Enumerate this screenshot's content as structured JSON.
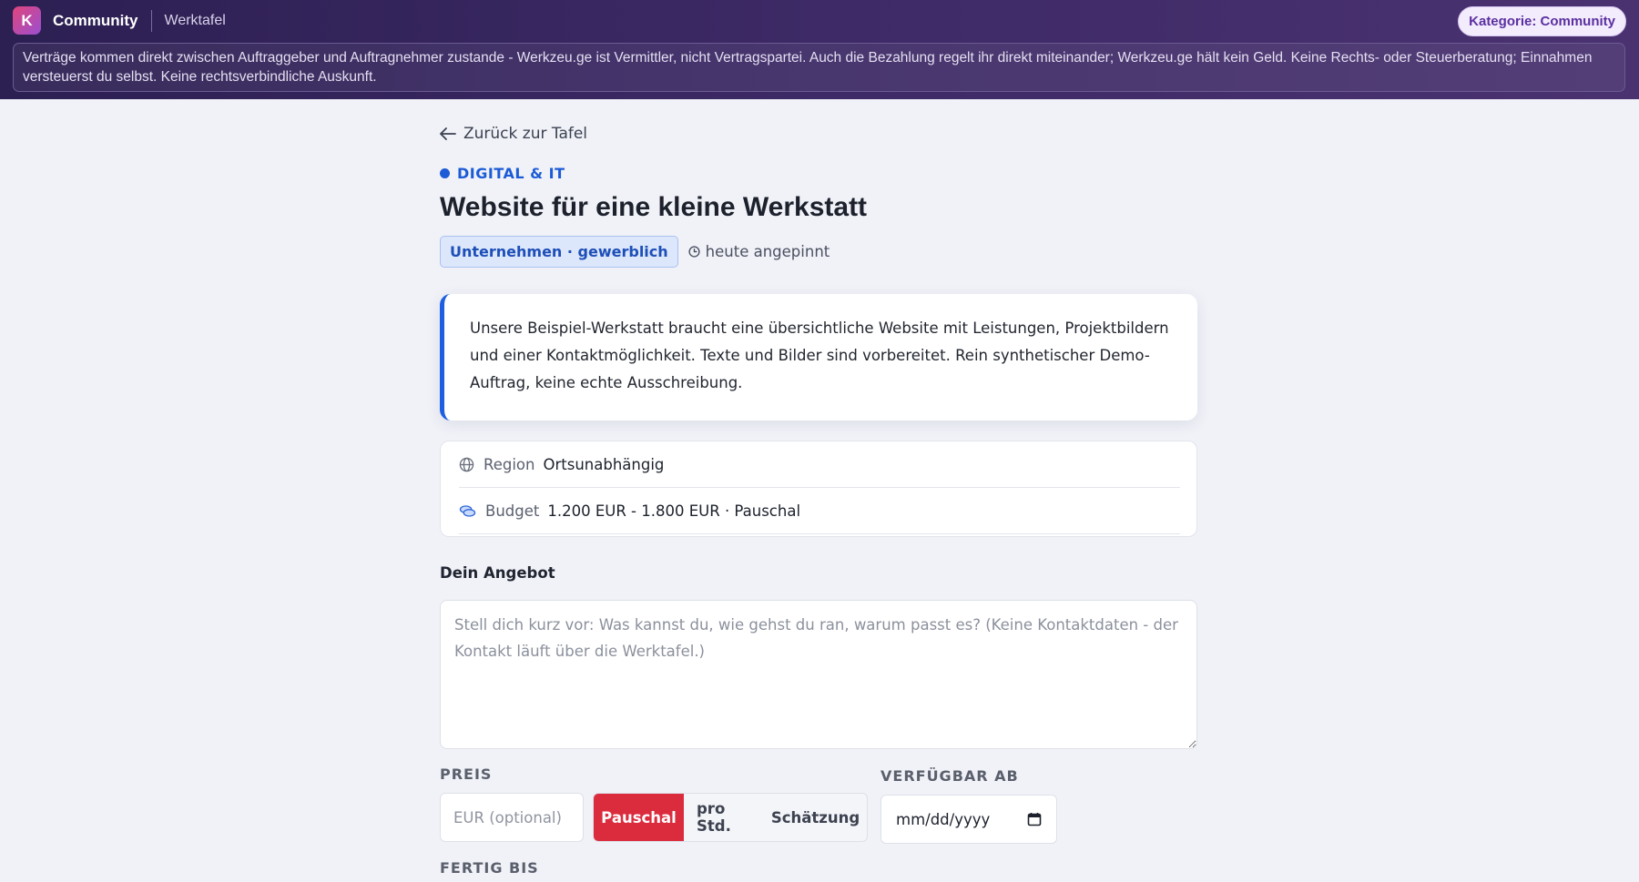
{
  "topbar": {
    "logo_letter": "K",
    "brand": "Community",
    "section": "Werktafel",
    "category_badge": "Kategorie: Community",
    "disclaimer": "Verträge kommen direkt zwischen Auftraggeber und Auftragnehmer zustande - Werkzeu.ge ist Vermittler, nicht Vertragspartei. Auch die Bezahlung regelt ihr direkt miteinander; Werkzeu.ge hält kein Geld. Keine Rechts- oder Steuerberatung; Einnahmen versteuerst du selbst. Keine rechtsverbindliche Auskunft."
  },
  "job": {
    "back_label": "Zurück zur Tafel",
    "category": "DIGITAL & IT",
    "title": "Website für eine kleine Werkstatt",
    "tag": "Unternehmen · gewerblich",
    "pinned": "heute angepinnt",
    "description": "Unsere Beispiel-Werkstatt braucht eine übersichtliche Website mit Leistungen, Projektbildern und einer Kontaktmöglichkeit. Texte und Bilder sind vorbereitet. Rein synthetischer Demo-Auftrag, keine echte Ausschreibung.",
    "region_label": "Region",
    "region_value": "Ortsunabhängig",
    "budget_label": "Budget",
    "budget_value": "1.200 EUR - 1.800 EUR · Pauschal"
  },
  "form": {
    "offer_label": "Dein Angebot",
    "offer_placeholder": "Stell dich kurz vor: Was kannst du, wie gehst du ran, warum passt es? (Keine Kontaktdaten - der Kontakt läuft über die Werktafel.)",
    "price_label": "PREIS",
    "price_placeholder": "EUR (optional)",
    "price_modes": [
      "Pauschal",
      "pro Std.",
      "Schätzung"
    ],
    "price_mode_selected": "Pauschal",
    "available_label": "VERFÜGBAR AB",
    "date_placeholder": "mm/dd/yyyy",
    "done_label": "FERTIG BIS"
  },
  "colors": {
    "accent_blue": "#1c5bd6",
    "active_red": "#db2c3e",
    "badge_purple": "#5b2fa0"
  }
}
